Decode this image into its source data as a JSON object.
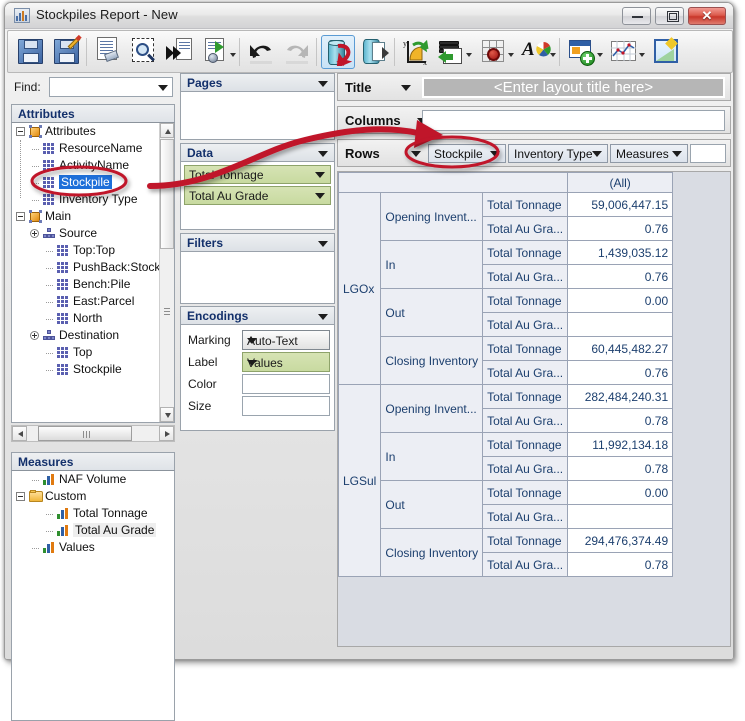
{
  "window": {
    "title": "Stockpiles Report - New",
    "icon": "report-chart-icon",
    "minimize_label": "",
    "maximize_label": "",
    "close_label": "✕"
  },
  "toolbar": {
    "items": [
      {
        "name": "save-button",
        "icon": "floppy-disk-icon",
        "tooltip": "Save"
      },
      {
        "name": "save-as-button",
        "icon": "floppy-disk-pencil-icon",
        "tooltip": "Save As"
      },
      {
        "name": "clear-layout-button",
        "icon": "document-eraser-icon",
        "tooltip": "Clear"
      },
      {
        "name": "preview-button",
        "icon": "document-magnifier-icon",
        "tooltip": "Preview"
      },
      {
        "name": "run-button",
        "icon": "document-fast-forward-icon",
        "tooltip": "Run"
      },
      {
        "name": "export-button",
        "icon": "document-export-gear-icon",
        "tooltip": "Export"
      },
      {
        "name": "undo-button",
        "icon": "undo-arrow-icon",
        "tooltip": "Undo"
      },
      {
        "name": "redo-button",
        "icon": "redo-arrow-icon",
        "tooltip": "Redo"
      },
      {
        "name": "refresh-data-button",
        "icon": "database-refresh-icon",
        "tooltip": "Refresh Data",
        "selected": true
      },
      {
        "name": "database-export-button",
        "icon": "database-arrow-icon",
        "tooltip": "Database Export"
      },
      {
        "name": "axis-button",
        "icon": "axis-xy-icon",
        "tooltip": "Axis"
      },
      {
        "name": "layers-button",
        "icon": "layers-arrow-icon",
        "tooltip": "Layers"
      },
      {
        "name": "grid-settings-button",
        "icon": "grid-gear-icon",
        "tooltip": "Grid Settings"
      },
      {
        "name": "font-color-button",
        "icon": "font-palette-icon",
        "tooltip": "Font / Color"
      },
      {
        "name": "add-view-button",
        "icon": "window-add-icon",
        "tooltip": "Add View"
      },
      {
        "name": "chart-view-button",
        "icon": "chart-table-icon",
        "tooltip": "Chart View"
      },
      {
        "name": "image-export-button",
        "icon": "picture-icon",
        "tooltip": "Image Export"
      }
    ]
  },
  "left_panel": {
    "find_label": "Find:",
    "find_value": "",
    "find_placeholder": "",
    "attributes_header": "Attributes",
    "attributes_tree": [
      {
        "label": "Attributes",
        "depth": 0,
        "icon": "cube-icon",
        "expander": "minus"
      },
      {
        "label": "ResourceName",
        "depth": 1,
        "icon": "attribute-icon",
        "expander": "none"
      },
      {
        "label": "ActivityName",
        "depth": 1,
        "icon": "attribute-icon",
        "expander": "none"
      },
      {
        "label": "Stockpile",
        "depth": 1,
        "icon": "attribute-icon",
        "expander": "none",
        "selected": true
      },
      {
        "label": "Inventory Type",
        "depth": 1,
        "icon": "attribute-icon",
        "expander": "none"
      },
      {
        "label": "Main",
        "depth": 0,
        "icon": "cube-icon",
        "expander": "minus"
      },
      {
        "label": "Source",
        "depth": 1,
        "icon": "hierarchy-icon",
        "expander": "plus"
      },
      {
        "label": "Top:Top",
        "depth": 2,
        "icon": "attribute-icon",
        "expander": "none"
      },
      {
        "label": "PushBack:Stock",
        "depth": 2,
        "icon": "attribute-icon",
        "expander": "none"
      },
      {
        "label": "Bench:Pile",
        "depth": 2,
        "icon": "attribute-icon",
        "expander": "none"
      },
      {
        "label": "East:Parcel",
        "depth": 2,
        "icon": "attribute-icon",
        "expander": "none"
      },
      {
        "label": "North",
        "depth": 2,
        "icon": "attribute-icon",
        "expander": "none"
      },
      {
        "label": "Destination",
        "depth": 1,
        "icon": "hierarchy-icon",
        "expander": "plus"
      },
      {
        "label": "Top",
        "depth": 2,
        "icon": "attribute-icon",
        "expander": "none"
      },
      {
        "label": "Stockpile",
        "depth": 2,
        "icon": "attribute-icon",
        "expander": "none"
      }
    ],
    "measures_header": "Measures",
    "measures_tree": [
      {
        "label": "NAF Volume",
        "depth": 1,
        "icon": "bar-chart-icon",
        "expander": "none"
      },
      {
        "label": "Custom",
        "depth": 0,
        "icon": "folder-icon",
        "expander": "minus"
      },
      {
        "label": "Total Tonnage",
        "depth": 2,
        "icon": "bar-chart-icon",
        "expander": "none"
      },
      {
        "label": "Total Au Grade",
        "depth": 2,
        "icon": "bar-chart-icon",
        "expander": "none",
        "hover": true
      },
      {
        "label": "Values",
        "depth": 1,
        "icon": "bar-chart-icon",
        "expander": "none"
      }
    ]
  },
  "shelves": {
    "pages": {
      "title": "Pages",
      "items": []
    },
    "data": {
      "title": "Data",
      "items": [
        "Total Tonnage",
        "Total Au Grade"
      ]
    },
    "filters": {
      "title": "Filters",
      "items": []
    },
    "encodings": {
      "title": "Encodings",
      "rows": [
        {
          "label": "Marking",
          "value": "Auto-Text",
          "style": "gray"
        },
        {
          "label": "Label",
          "value": "Values",
          "style": "green"
        },
        {
          "label": "Color",
          "value": "",
          "style": "white"
        },
        {
          "label": "Size",
          "value": "",
          "style": "white"
        }
      ]
    }
  },
  "layout": {
    "title_label": "Title",
    "title_value": "<Enter layout title here>",
    "columns_label": "Columns",
    "columns_value": "",
    "rows_label": "Rows",
    "rows_pills": [
      "Stockpile",
      "Inventory Type",
      "Measures"
    ]
  },
  "table": {
    "corner": "",
    "column_header": "(All)",
    "rows": [
      {
        "stockpile": "LGOx",
        "inventory_type": "Opening Invent...",
        "measure": "Total Tonnage",
        "value": "59,006,447.15"
      },
      {
        "stockpile": "LGOx",
        "inventory_type": "Opening Invent...",
        "measure": "Total Au Gra...",
        "value": "0.76"
      },
      {
        "stockpile": "LGOx",
        "inventory_type": "In",
        "measure": "Total Tonnage",
        "value": "1,439,035.12"
      },
      {
        "stockpile": "LGOx",
        "inventory_type": "In",
        "measure": "Total Au Gra...",
        "value": "0.76"
      },
      {
        "stockpile": "LGOx",
        "inventory_type": "Out",
        "measure": "Total Tonnage",
        "value": "0.00"
      },
      {
        "stockpile": "LGOx",
        "inventory_type": "Out",
        "measure": "Total Au Gra...",
        "value": ""
      },
      {
        "stockpile": "LGOx",
        "inventory_type": "Closing Inventory",
        "measure": "Total Tonnage",
        "value": "60,445,482.27"
      },
      {
        "stockpile": "LGOx",
        "inventory_type": "Closing Inventory",
        "measure": "Total Au Gra...",
        "value": "0.76"
      },
      {
        "stockpile": "LGSul",
        "inventory_type": "Opening Invent...",
        "measure": "Total Tonnage",
        "value": "282,484,240.31"
      },
      {
        "stockpile": "LGSul",
        "inventory_type": "Opening Invent...",
        "measure": "Total Au Gra...",
        "value": "0.78"
      },
      {
        "stockpile": "LGSul",
        "inventory_type": "In",
        "measure": "Total Tonnage",
        "value": "11,992,134.18"
      },
      {
        "stockpile": "LGSul",
        "inventory_type": "In",
        "measure": "Total Au Gra...",
        "value": "0.78"
      },
      {
        "stockpile": "LGSul",
        "inventory_type": "Out",
        "measure": "Total Tonnage",
        "value": "0.00"
      },
      {
        "stockpile": "LGSul",
        "inventory_type": "Out",
        "measure": "Total Au Gra...",
        "value": ""
      },
      {
        "stockpile": "LGSul",
        "inventory_type": "Closing Inventory",
        "measure": "Total Tonnage",
        "value": "294,476,374.49"
      },
      {
        "stockpile": "LGSul",
        "inventory_type": "Closing Inventory",
        "measure": "Total Au Gra...",
        "value": "0.78"
      }
    ]
  },
  "annotations": {
    "accent_color": "#c0152a",
    "ellipse_1_target": "Stockpile attribute in tree",
    "ellipse_2_target": "Stockpile pill on Rows shelf",
    "arrow_description": "curved arrow from Stockpile attribute to Rows shelf"
  }
}
